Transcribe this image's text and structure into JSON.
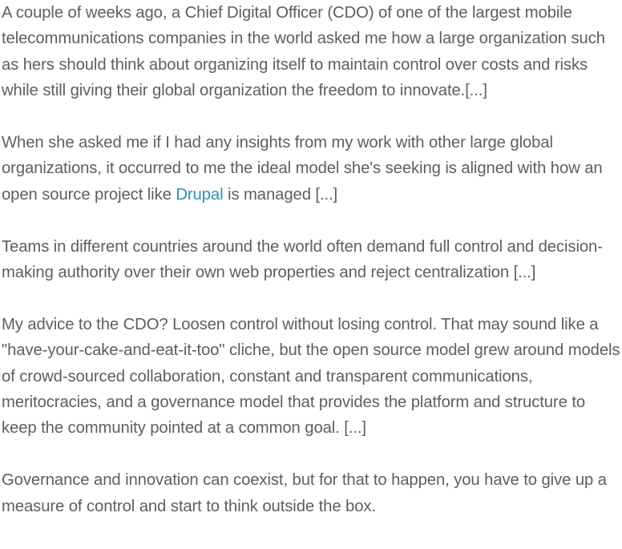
{
  "article": {
    "p1": "A couple of weeks ago, a Chief Digital Officer (CDO) of one of the largest mobile telecommunications companies in the world asked me how a large organization such as hers should think about organizing itself to maintain control over costs and risks while still giving their global organization the freedom to innovate.[...]",
    "p2_before": "When she asked me if I had any insights from my work with other large global organizations, it occurred to me the ideal model she's seeking is aligned with how an open source project like ",
    "p2_link": "Drupal",
    "p2_after": " is managed [...]",
    "p3": "Teams in different countries around the world often demand full control and decision-making authority over their own web properties and reject centralization [...]",
    "p4": "My advice to the CDO? Loosen control without losing control. That may sound like a \"have-your-cake-and-eat-it-too\" cliche, but the open source model grew around models of crowd-sourced collaboration, constant and transparent communications, meritocracies, and a governance model that provides the platform and structure to keep the community pointed at a common goal. [...]",
    "p5": "Governance and innovation can coexist, but for that to happen, you have to give up a measure of control and start to think outside the box."
  },
  "colors": {
    "text": "#5a5f66",
    "link": "#2d8fb5",
    "background": "#ffffff"
  }
}
